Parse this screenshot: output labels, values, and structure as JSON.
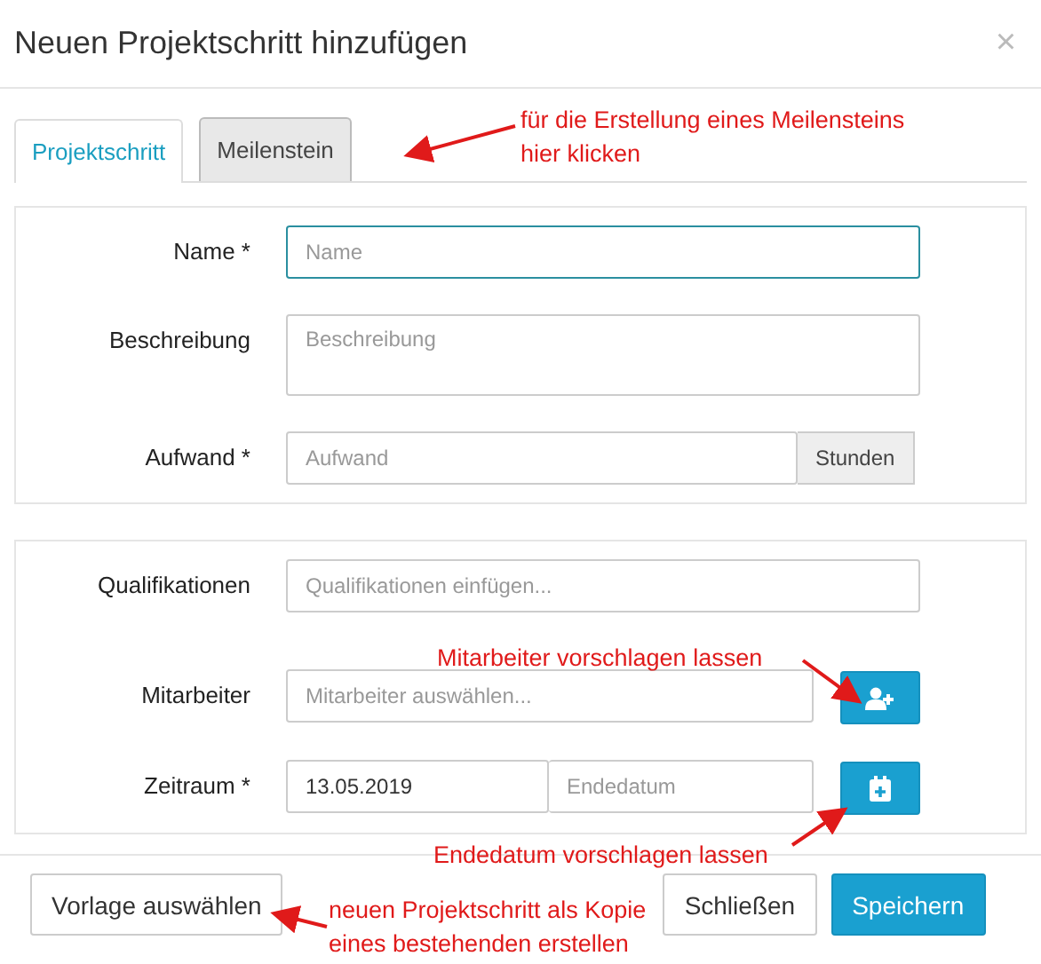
{
  "dialog": {
    "title": "Neuen Projektschritt hinzufügen",
    "close": "×"
  },
  "tabs": [
    {
      "label": "Projektschritt",
      "selected": true
    },
    {
      "label": "Meilenstein",
      "selected": false
    }
  ],
  "sections": [
    {
      "fields": [
        {
          "kind": "text",
          "label": "Name *",
          "placeholder": "Name",
          "focused": true
        },
        {
          "kind": "textarea",
          "label": "Beschreibung",
          "placeholder": "Beschreibung"
        },
        {
          "kind": "addon",
          "label": "Aufwand *",
          "placeholder": "Aufwand",
          "addon": "Stunden"
        }
      ]
    },
    {
      "fields": [
        {
          "kind": "text",
          "label": "Qualifikationen",
          "placeholder": "Qualifikationen einfügen..."
        },
        {
          "kind": "user",
          "label": "Mitarbeiter",
          "placeholder": "Mitarbeiter auswählen..."
        },
        {
          "kind": "range",
          "label": "Zeitraum *",
          "value": "13.05.2019",
          "placeholder": "Endedatum"
        }
      ]
    }
  ],
  "footer": {
    "template_button": "Vorlage auswählen",
    "close_button": "Schließen",
    "save_button": "Speichern"
  },
  "annotations": [
    {
      "text": "für die Erstellung eines Meilensteins hier klicken"
    },
    {
      "text": "Mitarbeiter vorschlagen lassen"
    },
    {
      "text": "Endedatum vorschlagen lassen"
    },
    {
      "text": "neuen Projektschritt als Kopie eines bestehenden erstellen"
    }
  ]
}
